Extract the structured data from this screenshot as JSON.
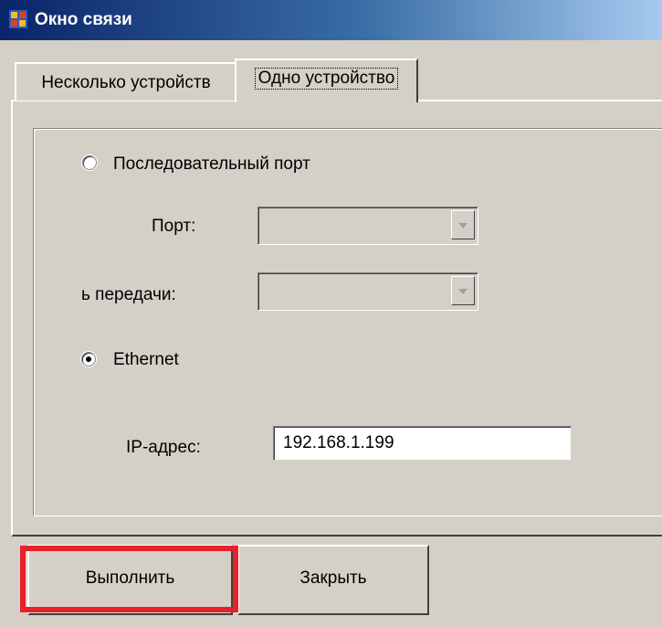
{
  "window": {
    "title": "Окно связи",
    "icon": "app-window-icon"
  },
  "tabs": [
    {
      "label": "Несколько устройств",
      "selected": false
    },
    {
      "label": "Одно устройство",
      "selected": true
    }
  ],
  "connection": {
    "serial": {
      "label": "Последовательный порт",
      "selected": false
    },
    "port": {
      "label": "Порт:",
      "value": ""
    },
    "baud": {
      "label": "ь передачи:",
      "value": ""
    },
    "ethernet": {
      "label": "Ethernet",
      "selected": true
    },
    "ip": {
      "label": "IP-адрес:",
      "value": "192.168.1.199"
    }
  },
  "buttons": {
    "run": "Выполнить",
    "close": "Закрыть"
  },
  "colors": {
    "highlight": "#e8202a",
    "titlebar": "#0a246a"
  }
}
